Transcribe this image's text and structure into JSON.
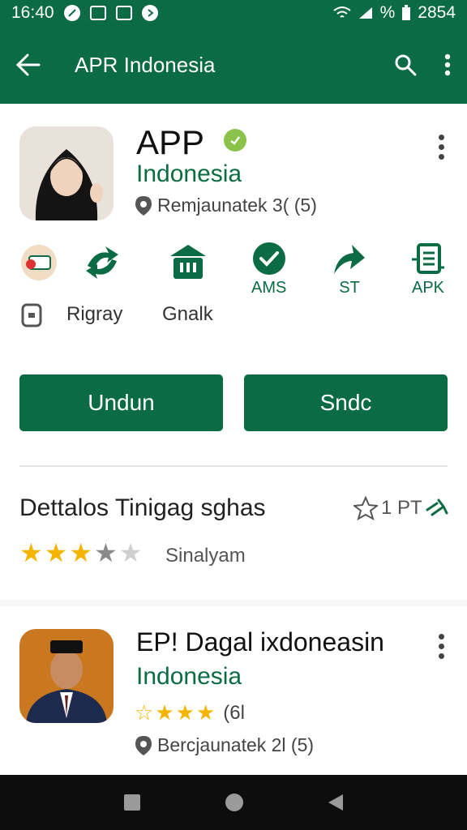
{
  "status_bar": {
    "time": "16:40",
    "battery_text": "% ",
    "right_value": "2854"
  },
  "app_bar": {
    "title": "APR Indonesia",
    "icons": [
      "back-arrow-icon",
      "search-icon",
      "more-vert-icon"
    ]
  },
  "app1": {
    "name": "APP",
    "publisher": "Indonesia",
    "meta": "Remjaunatek 3( (5)"
  },
  "tiles": [
    {
      "label": "AMS",
      "icon": "shield-check-icon"
    },
    {
      "label": "ST",
      "icon": "share-arrow-icon"
    },
    {
      "label": "APK",
      "icon": "document-stack-icon"
    }
  ],
  "plain_tiles": {
    "rigray": "Rigray",
    "gnalk": "Gnalk"
  },
  "buttons": {
    "primary": "Undun",
    "secondary": "Sndc"
  },
  "details": {
    "title": "Dettalos Tinigag sghas",
    "pt_label": "1 PT",
    "rating_label": "Sinalyam",
    "rating": 3.5
  },
  "app2": {
    "name": "EP! Dagal ixdoneasin",
    "publisher": "Indonesia",
    "rating_text": "(6l",
    "meta": "Bercjaunatek 2l (5)"
  },
  "colors": {
    "brand_green": "#0b6b45",
    "star_gold": "#f4b400",
    "verified_green": "#8bc34a"
  }
}
